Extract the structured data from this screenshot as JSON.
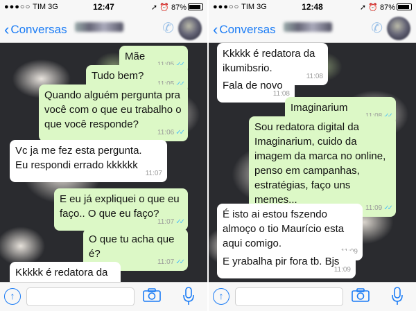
{
  "screens": [
    {
      "status": {
        "carrier": "TIM",
        "network": "3G",
        "time": "12:47",
        "battery": "87%"
      },
      "nav": {
        "back_label": "Conversas"
      },
      "messages": [
        {
          "dir": "out",
          "text": "Mãe",
          "time": "11:05"
        },
        {
          "dir": "out",
          "text": "Tudo bem?",
          "time": "11:05"
        },
        {
          "dir": "out",
          "text": "Quando alguém pergunta pra\nvocê com o que eu trabalho o\nque você responde?",
          "time": "11:06"
        },
        {
          "dir": "in",
          "text": "Vc ja me fez esta pergunta.\nEu respondi errado kkkkkk",
          "time": "11:07"
        },
        {
          "dir": "out",
          "text": "E eu já expliquei o que eu\nfaço.. O que eu faço?",
          "time": "11:07"
        },
        {
          "dir": "out",
          "text": "O que tu acha que é?",
          "time": "11:07"
        },
        {
          "dir": "in",
          "text": "Kkkkk é redatora da\nikumibsrio.",
          "time": ""
        }
      ]
    },
    {
      "status": {
        "carrier": "TIM",
        "network": "3G",
        "time": "12:48",
        "battery": "87%"
      },
      "nav": {
        "back_label": "Conversas"
      },
      "messages": [
        {
          "dir": "in",
          "text": "Kkkkk é redatora da\nikumibsrio.",
          "time": "11:08"
        },
        {
          "dir": "in",
          "text": "Fala de novo",
          "time": "11:08"
        },
        {
          "dir": "out",
          "text": "Imaginarium",
          "time": "11:08"
        },
        {
          "dir": "out",
          "text": "Sou redatora digital da\nImaginarium, cuido da\nimagem da marca no online,\npenso em campanhas,\nestratégias, faço uns\nmemes...",
          "time": "11:09"
        },
        {
          "dir": "in",
          "text": "É isto ai estou fszendo\nalmoço o tio Maurício esta\naqui comigo.",
          "time": "11:09"
        },
        {
          "dir": "in",
          "text": "E yrabalha pir fora tb. Bjs",
          "time": "11:09"
        }
      ]
    }
  ],
  "icons": {
    "back": "chevron-left-icon",
    "call": "phone-icon",
    "attach": "upload-icon",
    "camera": "camera-icon",
    "mic": "microphone-icon"
  },
  "colors": {
    "accent": "#1b7cf5",
    "outgoing_bubble": "#dcf8c6",
    "incoming_bubble": "#ffffff",
    "read_ticks": "#4fc3f7"
  }
}
